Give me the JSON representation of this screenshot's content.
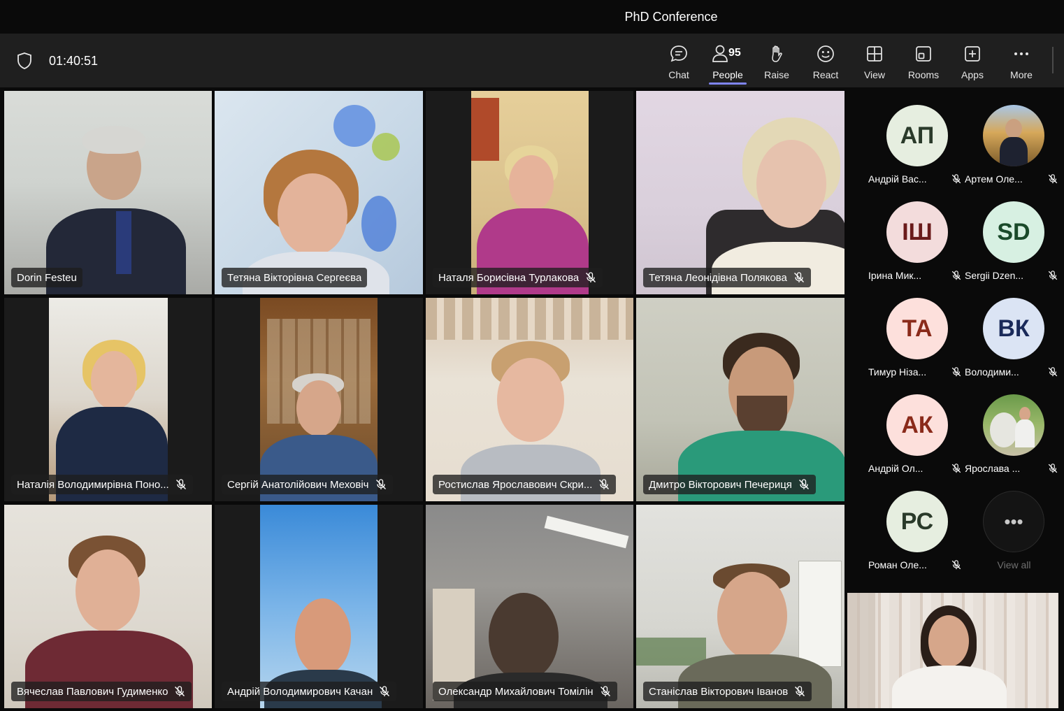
{
  "window": {
    "title": "PhD Conference"
  },
  "toolbar": {
    "timer": "01:40:51",
    "people_count": "95",
    "buttons": {
      "chat": "Chat",
      "people": "People",
      "raise": "Raise",
      "react": "React",
      "view": "View",
      "rooms": "Rooms",
      "apps": "Apps",
      "more": "More"
    }
  },
  "colors": {
    "accent": "#7f85f5",
    "toolbar_bg": "#1f1f1f"
  },
  "participants": [
    {
      "name": "Dorin Festeu",
      "muted": false,
      "speaking": true
    },
    {
      "name": "Тетяна Вікторівна Сергеєва",
      "muted": false
    },
    {
      "name": "Наталя Борисівна Турлакова",
      "muted": true
    },
    {
      "name": "Тетяна Леонідівна Полякова",
      "muted": true
    },
    {
      "name": "Наталія Володимирівна Поно...",
      "muted": true
    },
    {
      "name": "Сергій Анатолійович Меховіч",
      "muted": true
    },
    {
      "name": "Ростислав Ярославович Скри...",
      "muted": true
    },
    {
      "name": "Дмитро Вікторович Печериця",
      "muted": true
    },
    {
      "name": "Вячеслав Павлович Гудименко",
      "muted": true
    },
    {
      "name": "Андрій Володимирович Качан",
      "muted": true
    },
    {
      "name": "Олександр Михайлович Томілін",
      "muted": true
    },
    {
      "name": "Станіслав Вікторович Іванов",
      "muted": true
    }
  ],
  "roster": [
    {
      "initials": "АП",
      "name": "Андрій Вас...",
      "bg": "#e6eee0",
      "fg": "#2a3a2a"
    },
    {
      "initials": "",
      "name": "Артем Оле...",
      "photo": true
    },
    {
      "initials": "ІШ",
      "name": "Ірина Мик...",
      "bg": "#f3dcdc",
      "fg": "#6a1a1a"
    },
    {
      "initials": "SD",
      "name": "Sergii Dzen...",
      "bg": "#d7f0e2",
      "fg": "#1a4a2a"
    },
    {
      "initials": "ТА",
      "name": "Тимур Ніза...",
      "bg": "#fde0dc",
      "fg": "#8a2a1a"
    },
    {
      "initials": "ВК",
      "name": "Володими...",
      "bg": "#dbe4f4",
      "fg": "#1a2a5a"
    },
    {
      "initials": "АК",
      "name": "Андрій Ол...",
      "bg": "#fde0dc",
      "fg": "#8a2a1a"
    },
    {
      "initials": "",
      "name": "Ярослава ...",
      "photo": true
    },
    {
      "initials": "РС",
      "name": "Роман Оле...",
      "bg": "#e6eee0",
      "fg": "#2a3a2a"
    }
  ],
  "view_all": {
    "glyph": "•••",
    "label": "View all"
  }
}
